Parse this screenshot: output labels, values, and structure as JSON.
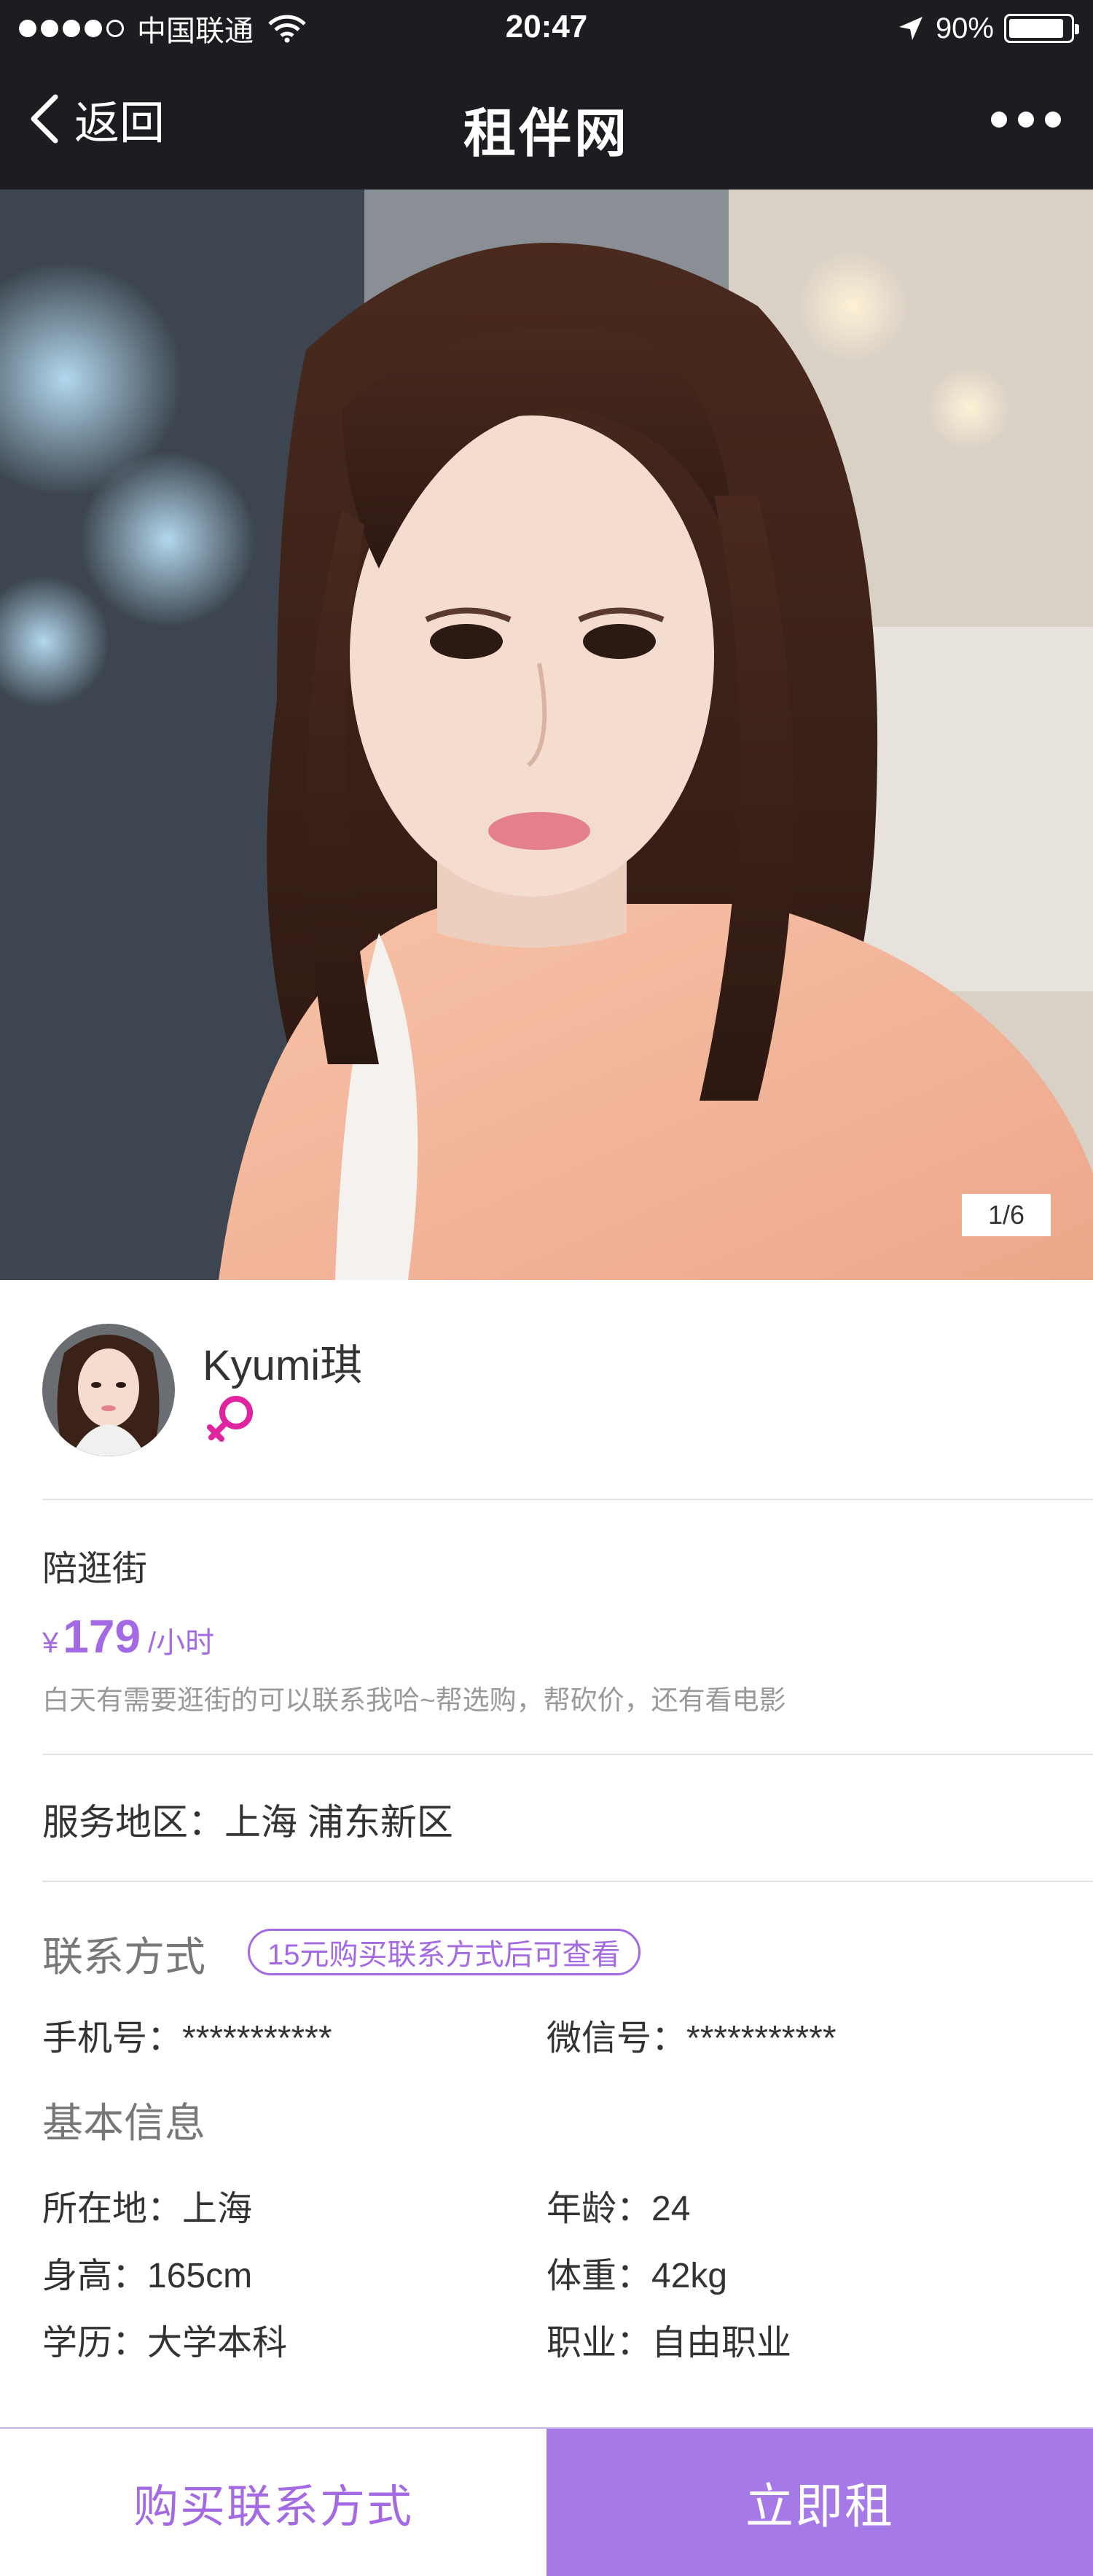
{
  "status_bar": {
    "carrier": "中国联通",
    "time": "20:47",
    "battery": "90%",
    "battery_level": 0.9
  },
  "nav": {
    "back_label": "返回",
    "title": "租伴网"
  },
  "photo": {
    "counter": "1/6"
  },
  "profile": {
    "name": "Kyumi琪",
    "gender": "female"
  },
  "service": {
    "name": "陪逛街",
    "currency": "¥",
    "price": "179",
    "unit": "/小时",
    "description": "白天有需要逛街的可以联系我哈~帮选购，帮砍价，还有看电影"
  },
  "area": {
    "label": "服务地区：",
    "value": "上海 浦东新区"
  },
  "contact": {
    "title": "联系方式",
    "badge": "15元购买联系方式后可查看",
    "phone_label": "手机号：",
    "phone_value": "***********",
    "wechat_label": "微信号：",
    "wechat_value": "***********"
  },
  "basic": {
    "title": "基本信息",
    "location_label": "所在地：",
    "location_value": "上海",
    "age_label": "年龄：",
    "age_value": "24",
    "height_label": "身高：",
    "height_value": "165cm",
    "weight_label": "体重：",
    "weight_value": "42kg",
    "education_label": "学历：",
    "education_value": "大学本科",
    "job_label": "职业：",
    "job_value": "自由职业"
  },
  "actions": {
    "buy_label": "购买联系方式",
    "rent_label": "立即租"
  },
  "colors": {
    "accent": "#a46ae3",
    "rent_button": "#a57ae6",
    "nav_bg": "#1c1c21",
    "gender_icon": "#e0239f"
  }
}
